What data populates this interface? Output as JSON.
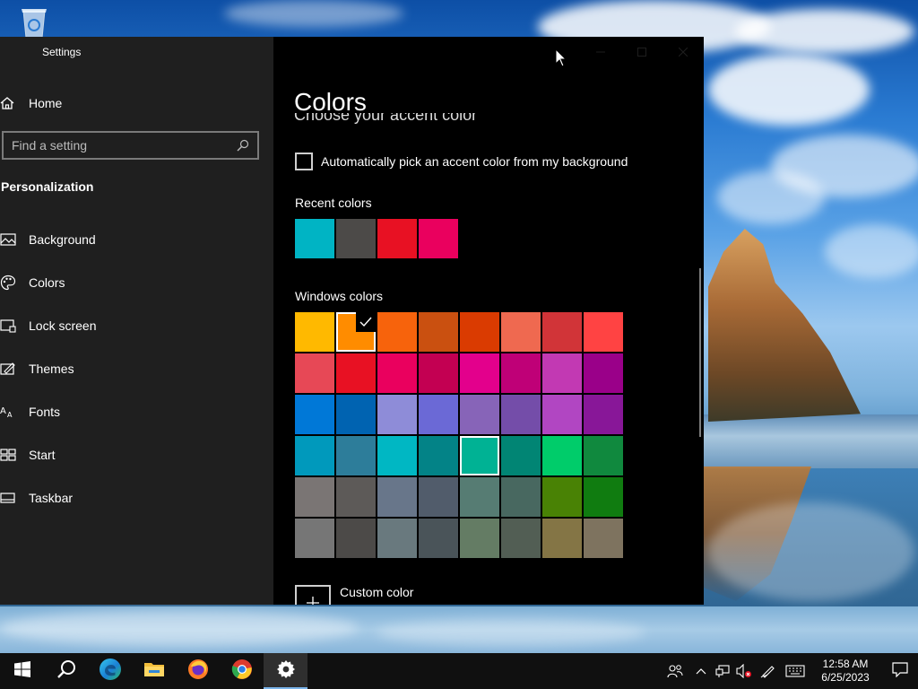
{
  "window": {
    "app_title": "Settings"
  },
  "nav": {
    "home_label": "Home",
    "search_placeholder": "Find a setting",
    "section_title": "Personalization",
    "items": [
      {
        "label": "Background",
        "icon": "picture-icon"
      },
      {
        "label": "Colors",
        "icon": "palette-icon"
      },
      {
        "label": "Lock screen",
        "icon": "lock-screen-icon"
      },
      {
        "label": "Themes",
        "icon": "themes-icon"
      },
      {
        "label": "Fonts",
        "icon": "fonts-icon"
      },
      {
        "label": "Start",
        "icon": "start-icon"
      },
      {
        "label": "Taskbar",
        "icon": "taskbar-icon"
      }
    ]
  },
  "content": {
    "page_title": "Colors",
    "clipped_heading": "Choose your accent color",
    "auto_accent_label": "Automatically pick an accent color from my background",
    "auto_accent_checked": false,
    "recent_label": "Recent colors",
    "recent_colors": [
      "#00b4c4",
      "#4c4a48",
      "#e81123",
      "#ea005e"
    ],
    "windows_label": "Windows colors",
    "windows_colors": [
      "#ffb900",
      "#ff8c00",
      "#f7630c",
      "#ca5010",
      "#da3b01",
      "#ef6950",
      "#d13438",
      "#ff4343",
      "#e74856",
      "#e81123",
      "#ea005e",
      "#c30052",
      "#e3008c",
      "#bf0077",
      "#c239b3",
      "#9a0089",
      "#0078d7",
      "#0063b1",
      "#8e8cd8",
      "#6b69d6",
      "#8764b8",
      "#744da9",
      "#b146c2",
      "#881798",
      "#0099bc",
      "#2d7d9a",
      "#00b7c3",
      "#038387",
      "#00b294",
      "#018574",
      "#00cc6a",
      "#10893e",
      "#7a7574",
      "#5d5a58",
      "#68768a",
      "#515c6b",
      "#567c73",
      "#486860",
      "#498205",
      "#107c10",
      "#767676",
      "#4c4a48",
      "#69797e",
      "#4a5459",
      "#647c64",
      "#525e54",
      "#847545",
      "#7e735f"
    ],
    "selected_color_index": 1,
    "hovered_color_index": 28,
    "custom_color_label": "Custom color"
  },
  "taskbar": {
    "apps": [
      {
        "name": "Search",
        "icon": "search-icon"
      },
      {
        "name": "Microsoft Edge",
        "icon": "edge-icon"
      },
      {
        "name": "File Explorer",
        "icon": "folder-icon"
      },
      {
        "name": "Firefox",
        "icon": "firefox-icon"
      },
      {
        "name": "Google Chrome",
        "icon": "chrome-icon"
      },
      {
        "name": "Settings",
        "icon": "gear-icon",
        "active": true
      }
    ],
    "clock_time": "12:58 AM",
    "clock_date": "6/25/2023"
  }
}
